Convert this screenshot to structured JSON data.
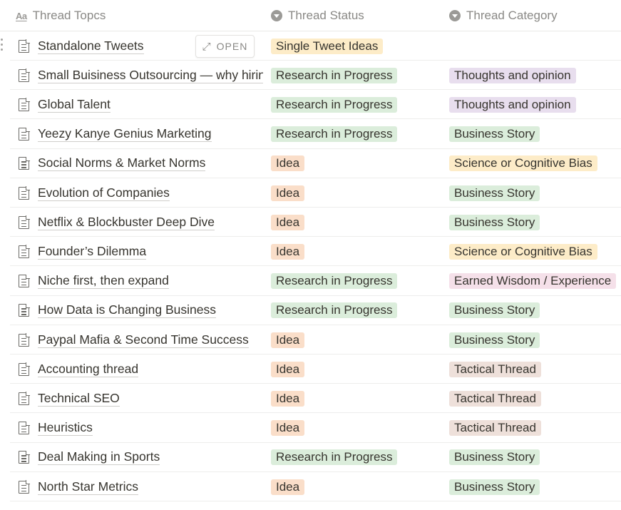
{
  "columns": {
    "title": "Thread Topcs",
    "status": "Thread Status",
    "category": "Thread Category"
  },
  "open_button": "OPEN",
  "tag_colors": {
    "Single Tweet Ideas": "yellow",
    "Research in Progress": "green",
    "Idea": "orange",
    "Thoughts and opinion": "purple",
    "Business Story": "green",
    "Science or Cognitive Bias": "yellow",
    "Earned Wisdom / Experience": "pink",
    "Tactical Thread": "brown"
  },
  "rows": [
    {
      "title": "Standalone Tweets",
      "status": "Single Tweet Ideas",
      "category": ""
    },
    {
      "title": "Small Buisiness Outsourcing — why hiring",
      "status": "Research in Progress",
      "category": "Thoughts and opinion"
    },
    {
      "title": "Global Talent",
      "status": "Research in Progress",
      "category": "Thoughts and opinion"
    },
    {
      "title": "Yeezy Kanye Genius Marketing",
      "status": "Research in Progress",
      "category": "Business Story"
    },
    {
      "title": "Social Norms & Market Norms",
      "status": "Idea",
      "category": "Science or Cognitive Bias"
    },
    {
      "title": "Evolution of Companies",
      "status": "Idea",
      "category": "Business Story"
    },
    {
      "title": "Netflix & Blockbuster Deep Dive",
      "status": "Idea",
      "category": "Business Story"
    },
    {
      "title": "Founder’s Dilemma",
      "status": "Idea",
      "category": "Science or Cognitive Bias"
    },
    {
      "title": "Niche first, then expand",
      "status": "Research in Progress",
      "category": "Earned Wisdom / Experience"
    },
    {
      "title": "How Data is Changing Business",
      "status": "Research in Progress",
      "category": "Business Story"
    },
    {
      "title": "Paypal Mafia & Second Time Success",
      "status": "Idea",
      "category": "Business Story"
    },
    {
      "title": "Accounting thread",
      "status": "Idea",
      "category": "Tactical Thread"
    },
    {
      "title": "Technical SEO",
      "status": "Idea",
      "category": "Tactical Thread"
    },
    {
      "title": "Heuristics",
      "status": "Idea",
      "category": "Tactical Thread"
    },
    {
      "title": "Deal Making in Sports",
      "status": "Research in Progress",
      "category": "Business Story"
    },
    {
      "title": "North Star Metrics",
      "status": "Idea",
      "category": "Business Story"
    }
  ]
}
